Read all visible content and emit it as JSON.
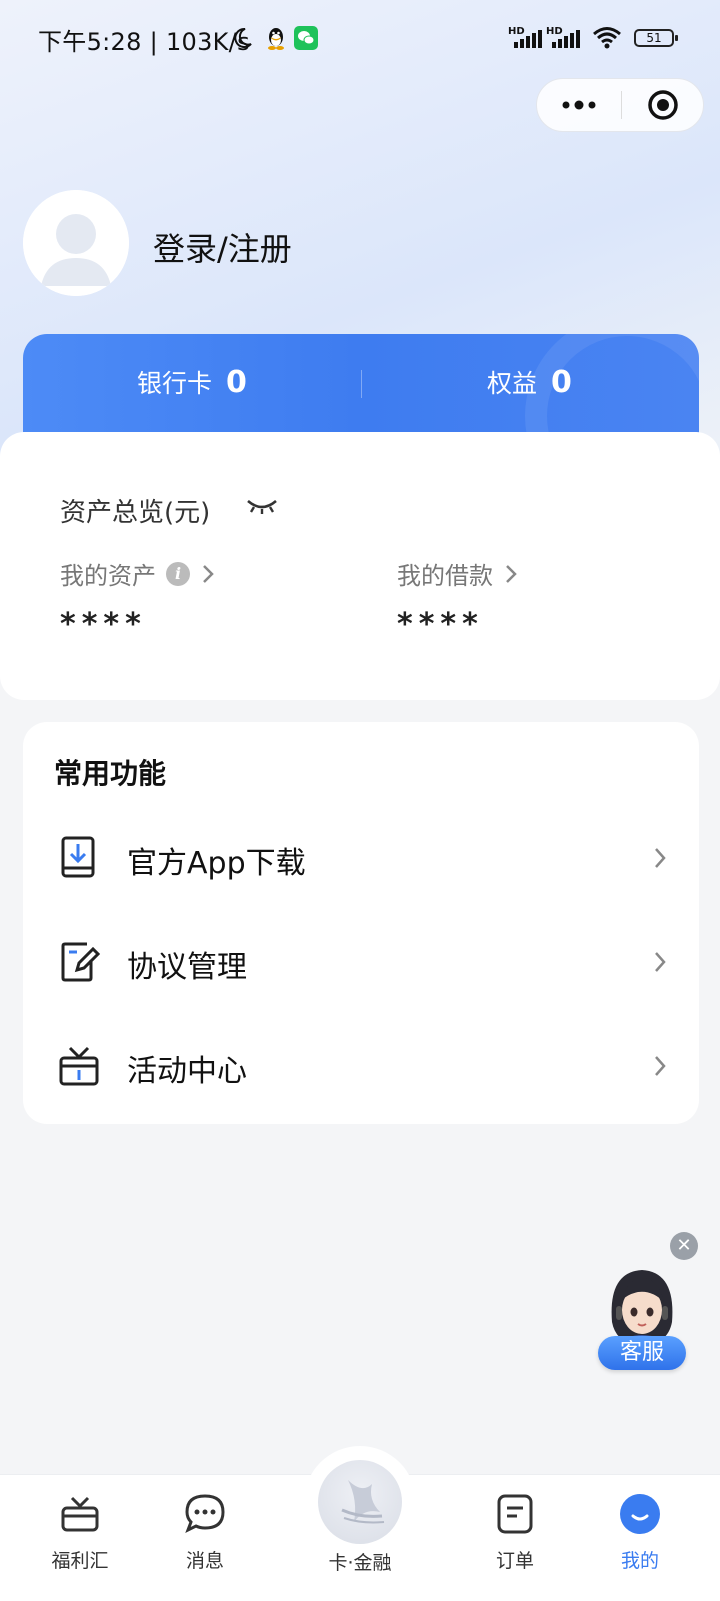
{
  "status_bar": {
    "time": "下午5:28 | 103K/s",
    "signal_label_1": "HD",
    "signal_label_2": "HD",
    "battery": "51"
  },
  "capsule": {
    "more_icon": "more-dots-icon",
    "close_icon": "target-circle-icon"
  },
  "profile": {
    "login_label": "登录/注册"
  },
  "summary_card": {
    "bank_card_label": "银行卡",
    "bank_card_value": "0",
    "rights_label": "权益",
    "rights_value": "0"
  },
  "assets": {
    "title": "资产总览(元)",
    "my_assets_label": "我的资产",
    "my_assets_value": "****",
    "my_loans_label": "我的借款",
    "my_loans_value": "****"
  },
  "functions": {
    "title": "常用功能",
    "items": [
      {
        "label": "官方App下载",
        "icon": "download-icon"
      },
      {
        "label": "协议管理",
        "icon": "agreement-edit-icon"
      },
      {
        "label": "活动中心",
        "icon": "gift-box-icon"
      }
    ]
  },
  "customer_service": {
    "label": "客服"
  },
  "tabbar": {
    "items": [
      {
        "label": "福利汇",
        "icon": "gift-icon"
      },
      {
        "label": "消息",
        "icon": "message-icon"
      },
      {
        "label": "卡·金融",
        "icon": "card-finance-logo"
      },
      {
        "label": "订单",
        "icon": "order-icon"
      },
      {
        "label": "我的",
        "icon": "profile-icon"
      }
    ],
    "active_index": 4,
    "active_color": "#3a7cf0"
  },
  "colors": {
    "brand_blue": "#3e7cf0",
    "background": "#f4f5f7"
  }
}
